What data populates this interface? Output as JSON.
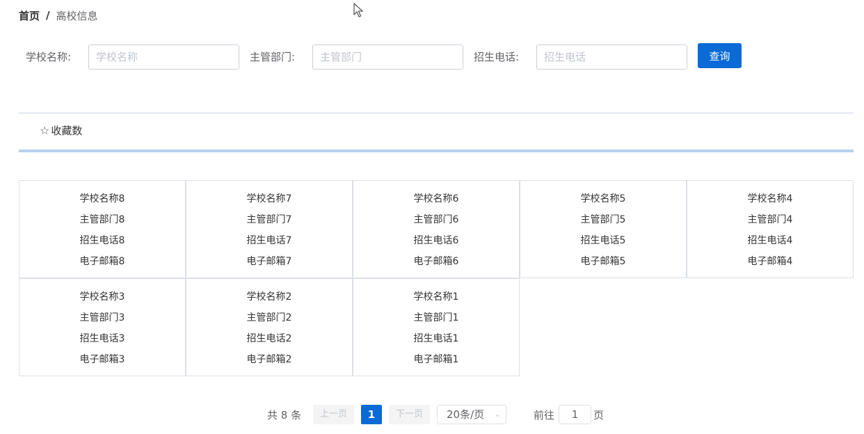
{
  "breadcrumb": {
    "home": "首页",
    "separator": "/",
    "current": "高校信息"
  },
  "search": {
    "school_name_label": "学校名称:",
    "school_name_placeholder": "学校名称",
    "department_label": "主管部门:",
    "department_placeholder": "主管部门",
    "phone_label": "招生电话:",
    "phone_placeholder": "招生电话",
    "query_button": "查询"
  },
  "tabs": {
    "favorites": "收藏数",
    "star_icon": "☆"
  },
  "schools": [
    {
      "name": "学校名称8",
      "department": "主管部门8",
      "phone": "招生电话8",
      "email": "电子邮箱8"
    },
    {
      "name": "学校名称7",
      "department": "主管部门7",
      "phone": "招生电话7",
      "email": "电子邮箱7"
    },
    {
      "name": "学校名称6",
      "department": "主管部门6",
      "phone": "招生电话6",
      "email": "电子邮箱6"
    },
    {
      "name": "学校名称5",
      "department": "主管部门5",
      "phone": "招生电话5",
      "email": "电子邮箱5"
    },
    {
      "name": "学校名称4",
      "department": "主管部门4",
      "phone": "招生电话4",
      "email": "电子邮箱4"
    },
    {
      "name": "学校名称3",
      "department": "主管部门3",
      "phone": "招生电话3",
      "email": "电子邮箱3"
    },
    {
      "name": "学校名称2",
      "department": "主管部门2",
      "phone": "招生电话2",
      "email": "电子邮箱2"
    },
    {
      "name": "学校名称1",
      "department": "主管部门1",
      "phone": "招生电话1",
      "email": "电子邮箱1"
    }
  ],
  "pagination": {
    "total": "共 8 条",
    "prev": "上一页",
    "current_page": "1",
    "next": "下一页",
    "page_size": "20条/页",
    "goto_label": "前往",
    "goto_value": "1",
    "goto_suffix": "页"
  },
  "colors": {
    "primary": "#0a6ad6",
    "tab_underline": "#b7d1ec",
    "border": "#dcdfe6"
  }
}
